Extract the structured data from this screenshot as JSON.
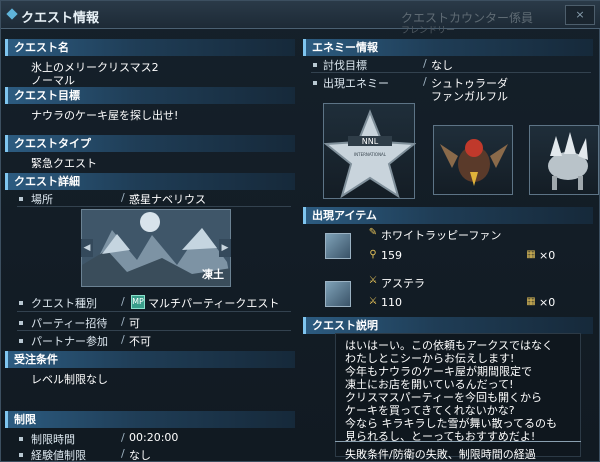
{
  "window": {
    "title": "クエスト情報",
    "ghost_title": "クエストカウンター係員",
    "ghost_sub": "フレンドリー",
    "close_label": "×"
  },
  "quest_name": {
    "header": "クエスト名",
    "line1": "氷上のメリークリスマス2",
    "line2": "ノーマル"
  },
  "quest_goal": {
    "header": "クエスト目標",
    "text": "ナウラのケーキ屋を探し出せ!"
  },
  "quest_type": {
    "header": "クエストタイプ",
    "value": "緊急クエスト"
  },
  "quest_detail": {
    "header": "クエスト詳細",
    "location_label": "場所",
    "location_value": "惑星ナベリウス",
    "map_caption": "凍土",
    "kind_label": "クエスト種別",
    "kind_icon": "MP",
    "kind_value": "マルチパーティークエスト",
    "party_invite_label": "パーティー招待",
    "party_invite_value": "可",
    "partner_label": "パートナー参加",
    "partner_value": "不可"
  },
  "order_conditions": {
    "header": "受注条件",
    "value": "レベル制限なし"
  },
  "limits": {
    "header": "制限",
    "time_label": "制限時間",
    "time_value": "00:20:00",
    "exp_label": "経験値制限",
    "exp_value": "なし"
  },
  "enemy_info": {
    "header": "エネミー情報",
    "target_label": "討伐目標",
    "target_value": "なし",
    "appear_label": "出現エネミー",
    "appear_line1": "シュトゥラーダ",
    "appear_line2": "ファンガルフル",
    "card1_badge_text": "NNL",
    "card1_sub_text": "INTERNATIONAL"
  },
  "items": {
    "header": "出現アイテム",
    "list": [
      {
        "name": "ホワイトラッピーファン",
        "count": "159",
        "qty": "×0"
      },
      {
        "name": "アステラ",
        "count": "110",
        "qty": "×0"
      }
    ]
  },
  "quest_description": {
    "header": "クエスト説明",
    "lines": [
      "はいはーい。この依頼もアークスではなく",
      "わたしとこシーからお伝えします!",
      "今年もナウラのケーキ屋が期間限定で",
      "凍土にお店を開いているんだって!",
      "クリスマスパーティーを今回も開くから",
      "ケーキを買ってきてくれないかな?",
      "今なら キラキラした雪が舞い散ってるのも",
      "見られるし、とーってもおすすめだよ!"
    ],
    "fail_text": "失敗条件/防衛の失敗、制限時間の経過"
  },
  "colors": {
    "accent": "#7fc5ef",
    "header_bg": "#2c5b80",
    "panel_bg": "#111a22"
  }
}
